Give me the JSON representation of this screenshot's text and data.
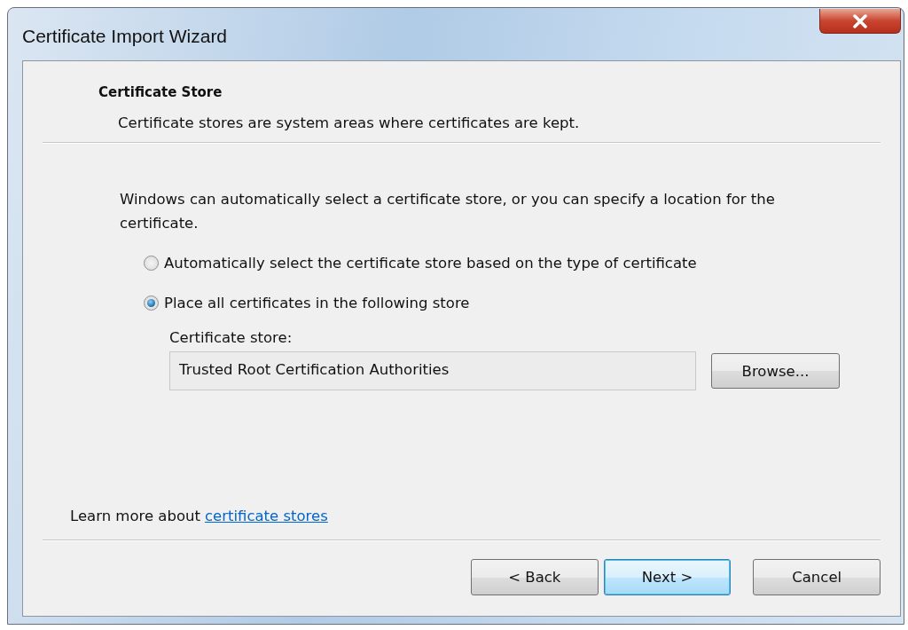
{
  "window": {
    "title": "Certificate Import Wizard"
  },
  "header": {
    "title": "Certificate Store",
    "subtitle": "Certificate stores are system areas where certificates are kept."
  },
  "description": "Windows can automatically select a certificate store, or you can specify a location for the certificate.",
  "options": [
    {
      "label": "Automatically select the certificate store based on the type of certificate",
      "selected": false
    },
    {
      "label": "Place all certificates in the following store",
      "selected": true
    }
  ],
  "store": {
    "label": "Certificate store:",
    "value": "Trusted Root Certification Authorities",
    "browse": "Browse..."
  },
  "learn_more": {
    "text": "Learn more about",
    "link": "certificate stores"
  },
  "buttons": [
    {
      "label": "< Back",
      "default": false
    },
    {
      "label": "Next >",
      "default": true
    },
    {
      "label": "Cancel",
      "default": false
    }
  ]
}
